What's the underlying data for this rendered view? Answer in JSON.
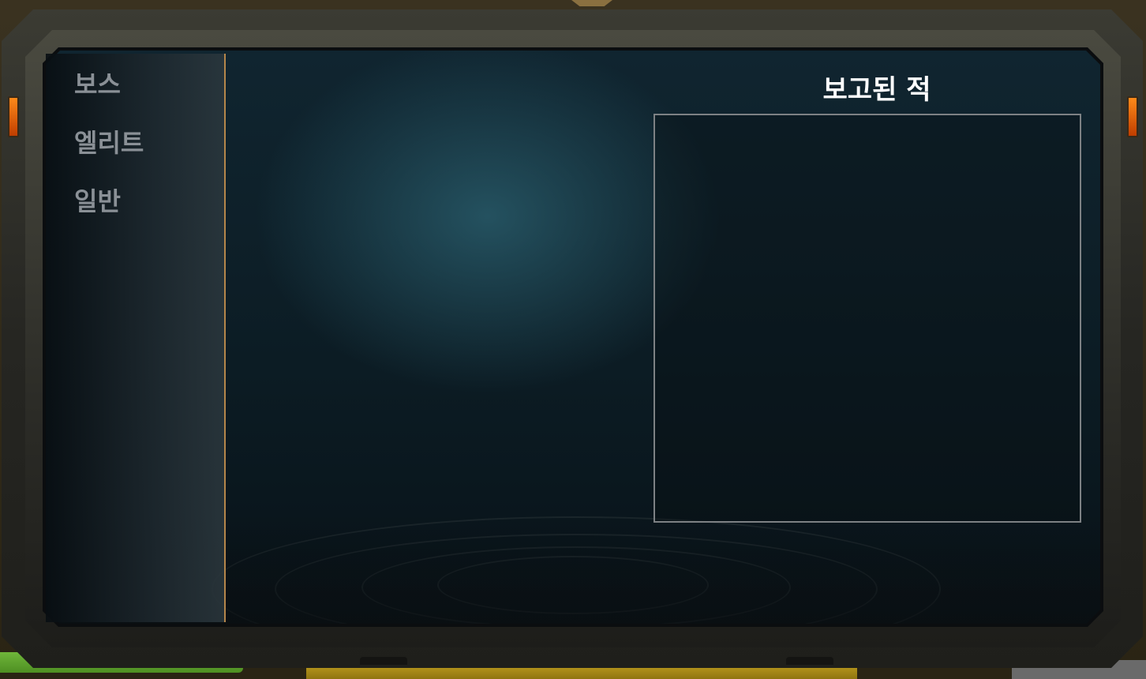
{
  "categories": {
    "items": [
      {
        "label": "보스"
      },
      {
        "label": "엘리트"
      },
      {
        "label": "일반"
      }
    ]
  },
  "reported_enemies": {
    "title": "보고된 적"
  },
  "colors": {
    "frame": "#2c2c27",
    "screen": "#0c1c24",
    "accent_divider": "#b5864a",
    "indicator_light": "#ff8a1a",
    "category_text": "#8a9096",
    "heading_text": "#ffffff",
    "box_border": "#7d8184"
  }
}
